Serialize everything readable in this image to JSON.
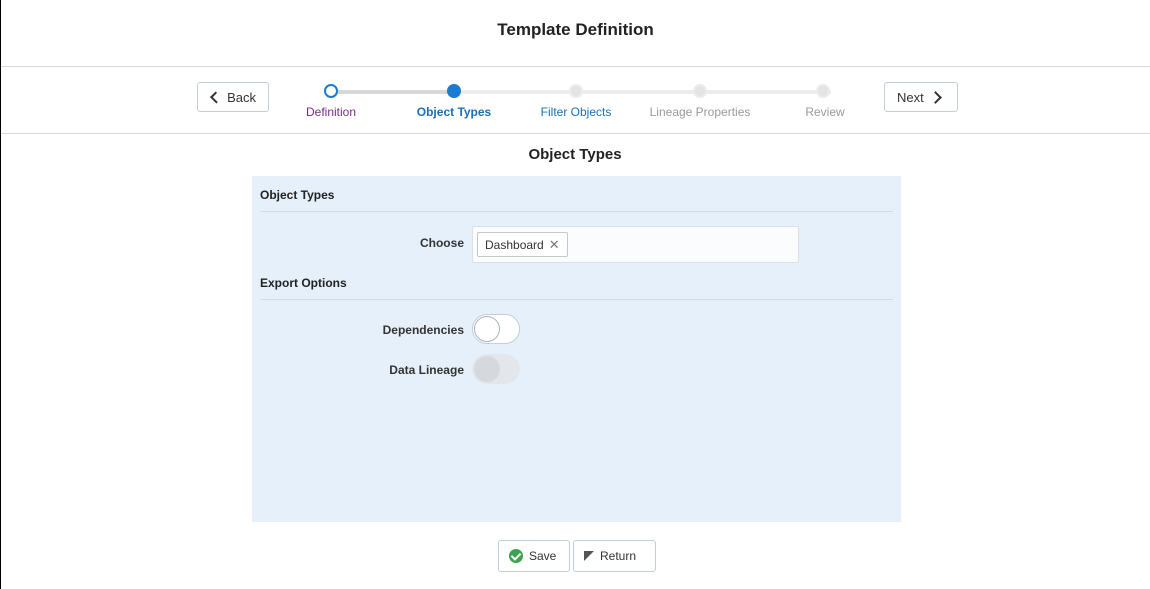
{
  "header": {
    "title": "Template Definition"
  },
  "train": {
    "back_label": "Back",
    "next_label": "Next",
    "stops": [
      {
        "label": "Definition",
        "state": "visited"
      },
      {
        "label": "Object Types",
        "state": "current"
      },
      {
        "label": "Filter Objects",
        "state": "link"
      },
      {
        "label": "Lineage Properties",
        "state": "disabled"
      },
      {
        "label": "Review",
        "state": "disabled"
      }
    ]
  },
  "section": {
    "title": "Object Types"
  },
  "form": {
    "object_types_header": "Object Types",
    "choose_label": "Choose",
    "chips": [
      "Dashboard"
    ],
    "export_options_header": "Export Options",
    "dependencies_label": "Dependencies",
    "dependencies_on": false,
    "data_lineage_label": "Data Lineage",
    "data_lineage_enabled": false
  },
  "footer": {
    "save_label": "Save",
    "return_label": "Return"
  },
  "colors": {
    "accent": "#1a7bd1",
    "panel": "#e6f0fa",
    "visited": "#7a2a8a",
    "save_icon": "#3aa44e"
  }
}
